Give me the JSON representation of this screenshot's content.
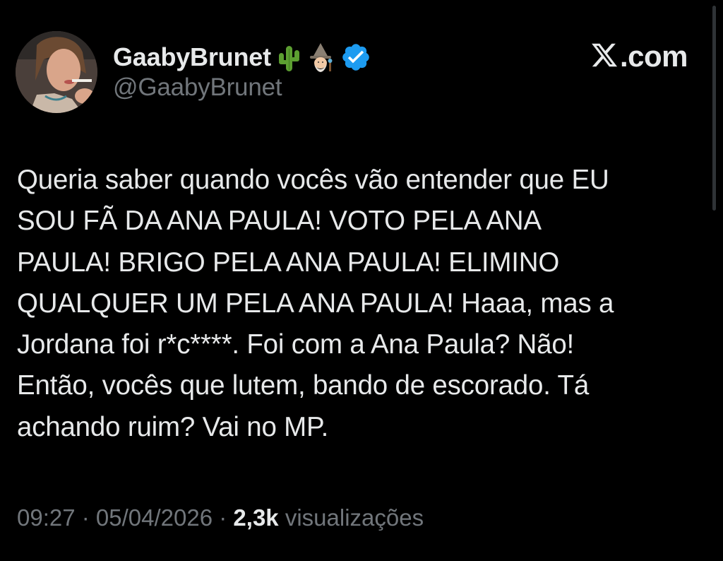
{
  "tweet": {
    "display_name": "GaabyBrunet",
    "handle": "@GaabyBrunet",
    "name_emojis": [
      "cactus-emoji",
      "mage-emoji"
    ],
    "verified_icon": "verified-badge-icon",
    "brand": {
      "logo_icon": "x-logo-icon",
      "text": ".com"
    },
    "text": "Queria saber quando vocês vão entender que EU\nSOU FÃ DA ANA PAULA! VOTO PELA ANA\nPAULA! BRIGO PELA ANA PAULA! ELIMINO\nQUALQUER UM PELA ANA PAULA! Haaa, mas a\nJordana foi r*c****. Foi com a Ana Paula? Não!\nEntão, vocês que lutem, bando de escorado. Tá\nachando ruim? Vai no MP.",
    "time": "09:27",
    "separator": " · ",
    "date": "05/04/2026",
    "views_count": "2,3k",
    "views_label": "visualizações"
  },
  "colors": {
    "background": "#000000",
    "text": "#e7e9ea",
    "muted": "#71767b",
    "verified": "#1d9bf0"
  }
}
